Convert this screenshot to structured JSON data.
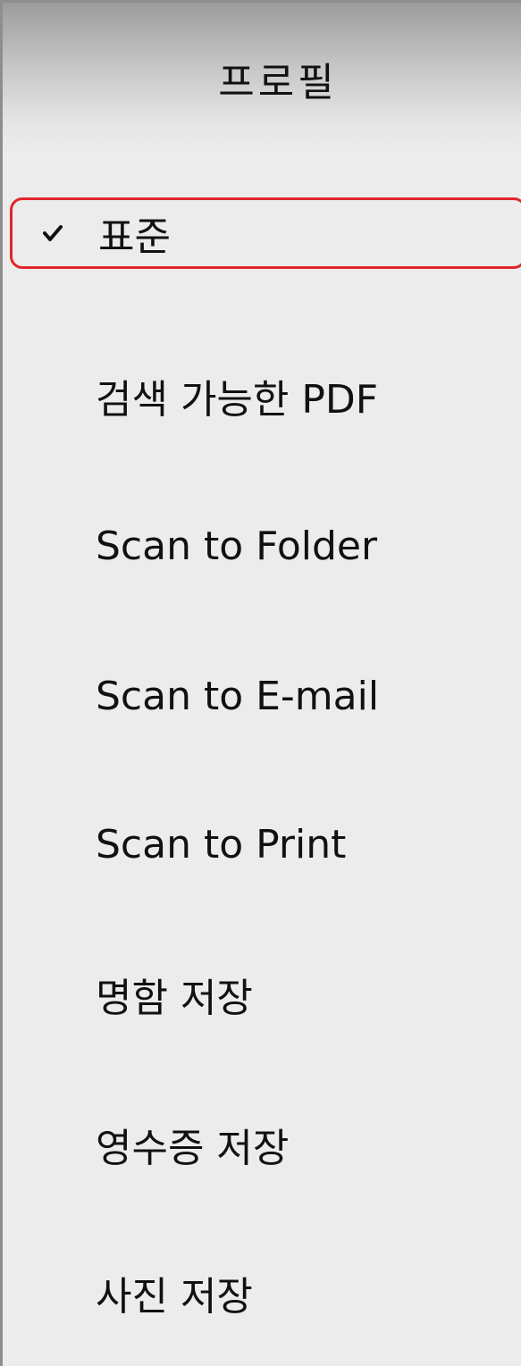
{
  "header": {
    "title": "프로필"
  },
  "menu": {
    "items": [
      {
        "label": "표준",
        "checked": true
      },
      {
        "label": "검색 가능한 PDF",
        "checked": false
      },
      {
        "label": "Scan to Folder",
        "checked": false
      },
      {
        "label": "Scan to E-mail",
        "checked": false
      },
      {
        "label": "Scan to Print",
        "checked": false
      },
      {
        "label": "명함 저장",
        "checked": false
      },
      {
        "label": "영수증 저장",
        "checked": false
      },
      {
        "label": "사진 저장",
        "checked": false
      }
    ]
  },
  "colors": {
    "panel_background": "#ececec",
    "selection_outline": "#e0262b",
    "text": "#111111",
    "panel_border": "#8e8e8e"
  },
  "icons": {
    "check": "checkmark-icon"
  }
}
